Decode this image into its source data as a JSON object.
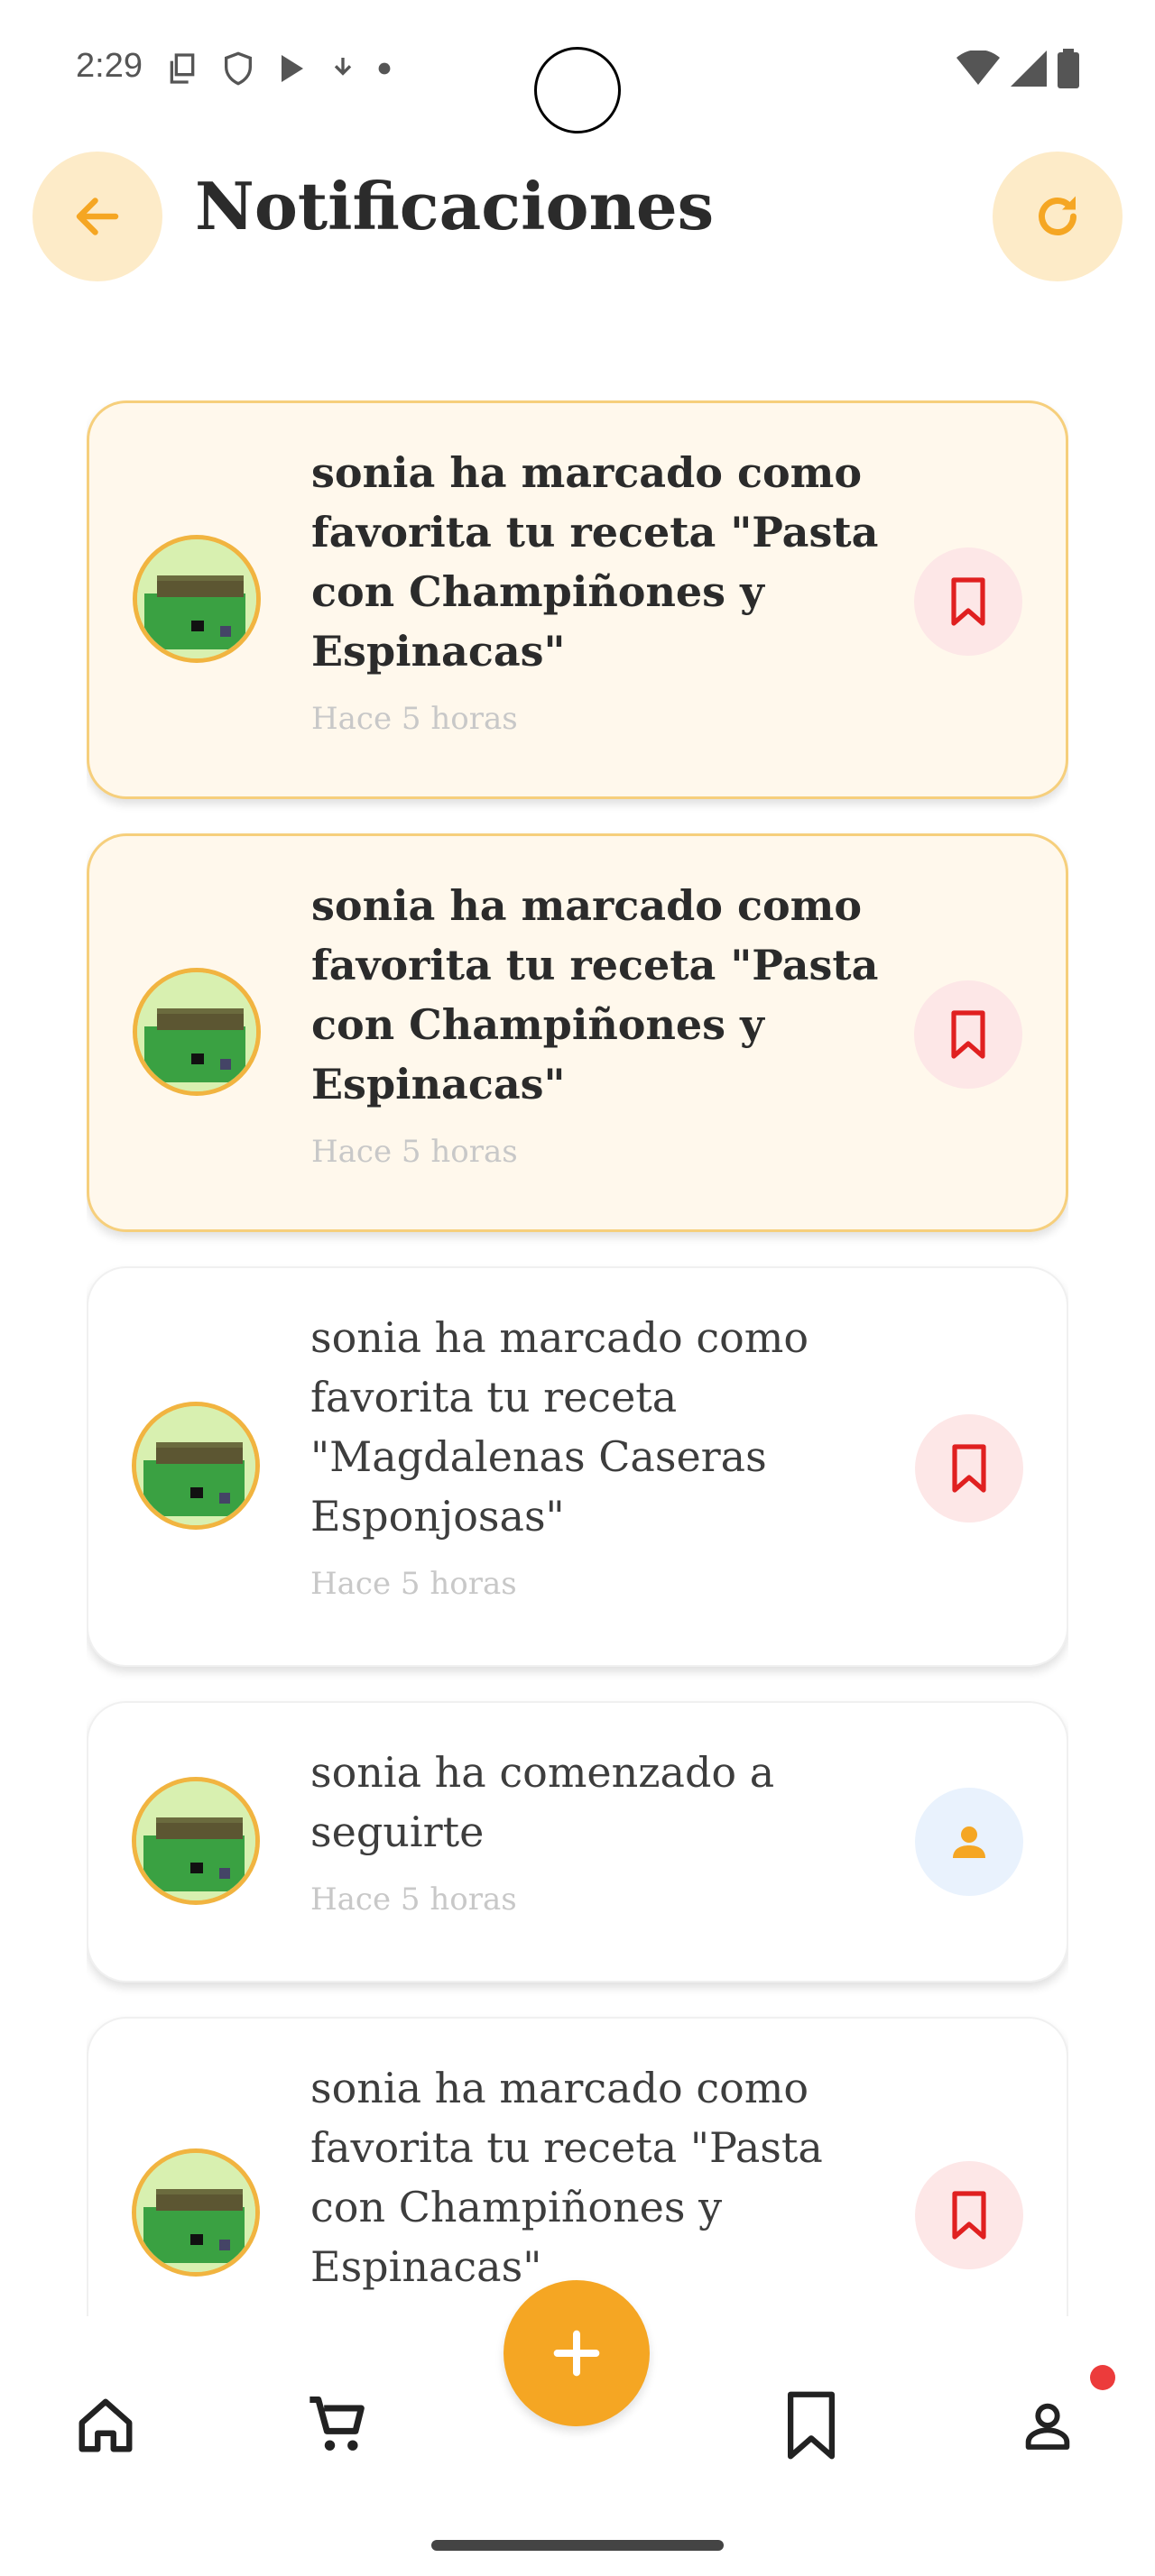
{
  "status_bar": {
    "time": "2:29",
    "left_icons": [
      "copy-icon",
      "shield-icon",
      "play-store-icon",
      "download-icon",
      "dot-icon"
    ],
    "right_icons": [
      "wifi-icon",
      "signal-icon",
      "battery-icon"
    ]
  },
  "header": {
    "title": "Notificaciones",
    "back_icon": "arrow-left-icon",
    "refresh_icon": "refresh-icon",
    "accent_color": "#f5a623",
    "button_bg": "#fdebc8"
  },
  "notifications": [
    {
      "message": "sonia ha marcado como favorita tu receta \"Pasta con Champiñones y Espinacas\"",
      "time": "Hace 5 horas",
      "unread": true,
      "action_icon": "bookmark-icon"
    },
    {
      "message": "sonia ha marcado como favorita tu receta \"Pasta con Champiñones y Espinacas\"",
      "time": "Hace 5 horas",
      "unread": true,
      "action_icon": "bookmark-icon"
    },
    {
      "message": "sonia ha marcado como favorita tu receta \"Magdalenas Caseras Esponjosas\"",
      "time": "Hace 5 horas",
      "unread": false,
      "action_icon": "bookmark-icon"
    },
    {
      "message": "sonia ha comenzado a seguirte",
      "time": "Hace 5 horas",
      "unread": false,
      "action_icon": "person-icon"
    },
    {
      "message": "sonia ha marcado como favorita tu receta \"Pasta con Champiñones y Espinacas\"",
      "time": "",
      "unread": false,
      "action_icon": "bookmark-icon"
    }
  ],
  "bottom_nav": {
    "items": [
      "home-icon",
      "cart-icon",
      "add-icon",
      "bookmark-icon",
      "profile-icon"
    ],
    "fab_color": "#f5a623",
    "badge_color": "#ec3b3b"
  }
}
